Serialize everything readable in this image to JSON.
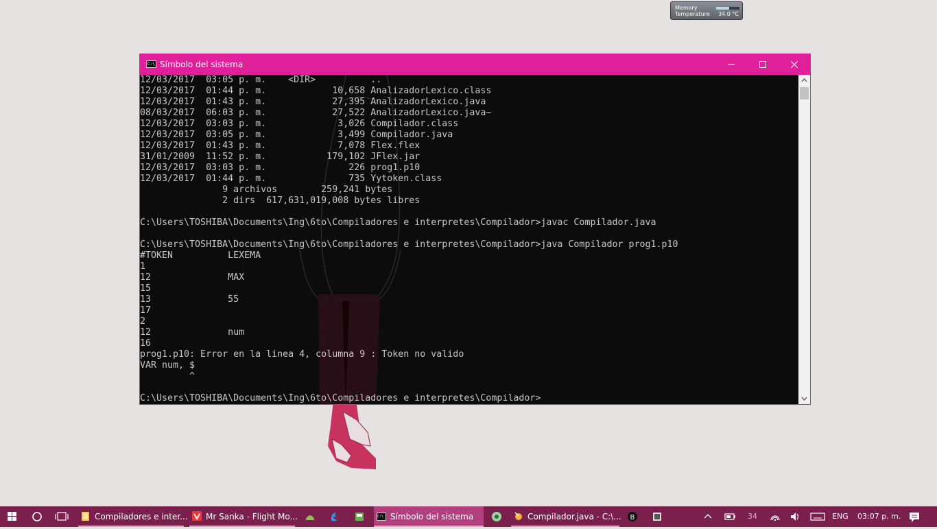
{
  "gadget": {
    "memory_label": "Memory",
    "temperature_label": "Temperature",
    "temperature_value": "34.0 °C",
    "memory_fraction": 0.55
  },
  "window": {
    "title": "Símbolo del sistema",
    "lines": [
      "12/03/2017  03:05 p. m.    <DIR>          ..",
      "12/03/2017  01:44 p. m.            10,658 AnalizadorLexico.class",
      "12/03/2017  01:43 p. m.            27,395 AnalizadorLexico.java",
      "08/03/2017  06:03 p. m.            27,522 AnalizadorLexico.java~",
      "12/03/2017  03:03 p. m.             3,026 Compilador.class",
      "12/03/2017  03:05 p. m.             3,499 Compilador.java",
      "12/03/2017  01:43 p. m.             7,078 Flex.flex",
      "31/01/2009  11:52 p. m.           179,102 JFlex.jar",
      "12/03/2017  03:03 p. m.               226 prog1.p10",
      "12/03/2017  01:44 p. m.               735 Yytoken.class",
      "               9 archivos        259,241 bytes",
      "               2 dirs  617,631,019,008 bytes libres",
      "",
      "C:\\Users\\TOSHIBA\\Documents\\Ing\\6to\\Compiladores e interpretes\\Compilador>javac Compilador.java",
      "",
      "C:\\Users\\TOSHIBA\\Documents\\Ing\\6to\\Compiladores e interpretes\\Compilador>java Compilador prog1.p10",
      "#TOKEN          LEXEMA",
      "1",
      "12              MAX",
      "15",
      "13              55",
      "17",
      "2",
      "12              num",
      "16",
      "prog1.p10: Error en la linea 4, columna 9 : Token no valido",
      "VAR num, $",
      "         ^",
      "",
      "C:\\Users\\TOSHIBA\\Documents\\Ing\\6to\\Compiladores e interpretes\\Compilador>"
    ]
  },
  "taskbar": {
    "apps": [
      {
        "label": "Compiladores e inter...",
        "icon": "folder-icon"
      },
      {
        "label": "Mr Sanka - Flight Mo...",
        "icon": "vivaldi-icon"
      },
      {
        "label": "Símbolo del sistema",
        "icon": "cmd-icon"
      },
      {
        "label": "Compilador.java - C:\\...",
        "icon": "jedit-icon"
      }
    ],
    "tray": {
      "temp": "34",
      "language": "ENG",
      "time": "03:07 p. m."
    }
  },
  "colors": {
    "accent": "#e0209a",
    "taskbar": "#7b1f4c",
    "console_bg": "#0c0c0c",
    "console_text": "#c8c8c8"
  }
}
